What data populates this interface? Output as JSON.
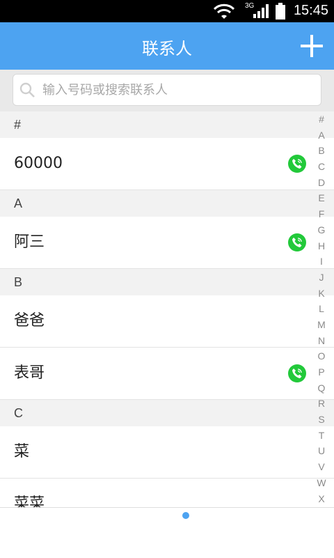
{
  "status_bar": {
    "time": "15:45",
    "network": "3G"
  },
  "app_bar": {
    "title": "联系人"
  },
  "search": {
    "placeholder": "输入号码或搜索联系人"
  },
  "contacts": [
    {
      "type": "section",
      "label": "#"
    },
    {
      "type": "contact",
      "name": "60000",
      "has_call": true
    },
    {
      "type": "section",
      "label": "A"
    },
    {
      "type": "contact",
      "name": "阿三",
      "has_call": true
    },
    {
      "type": "section",
      "label": "B"
    },
    {
      "type": "contact",
      "name": "爸爸",
      "has_call": false
    },
    {
      "type": "contact",
      "name": "表哥",
      "has_call": true
    },
    {
      "type": "section",
      "label": "C"
    },
    {
      "type": "contact",
      "name": "菜",
      "has_call": false
    },
    {
      "type": "contact",
      "name": "菜菜",
      "has_call": false
    }
  ],
  "index_letters": [
    "#",
    "A",
    "B",
    "C",
    "D",
    "E",
    "F",
    "G",
    "H",
    "I",
    "J",
    "K",
    "L",
    "M",
    "N",
    "O",
    "P",
    "Q",
    "R",
    "S",
    "T",
    "U",
    "V",
    "W",
    "X"
  ],
  "colors": {
    "accent": "#4da3f1",
    "call": "#22c93a"
  }
}
